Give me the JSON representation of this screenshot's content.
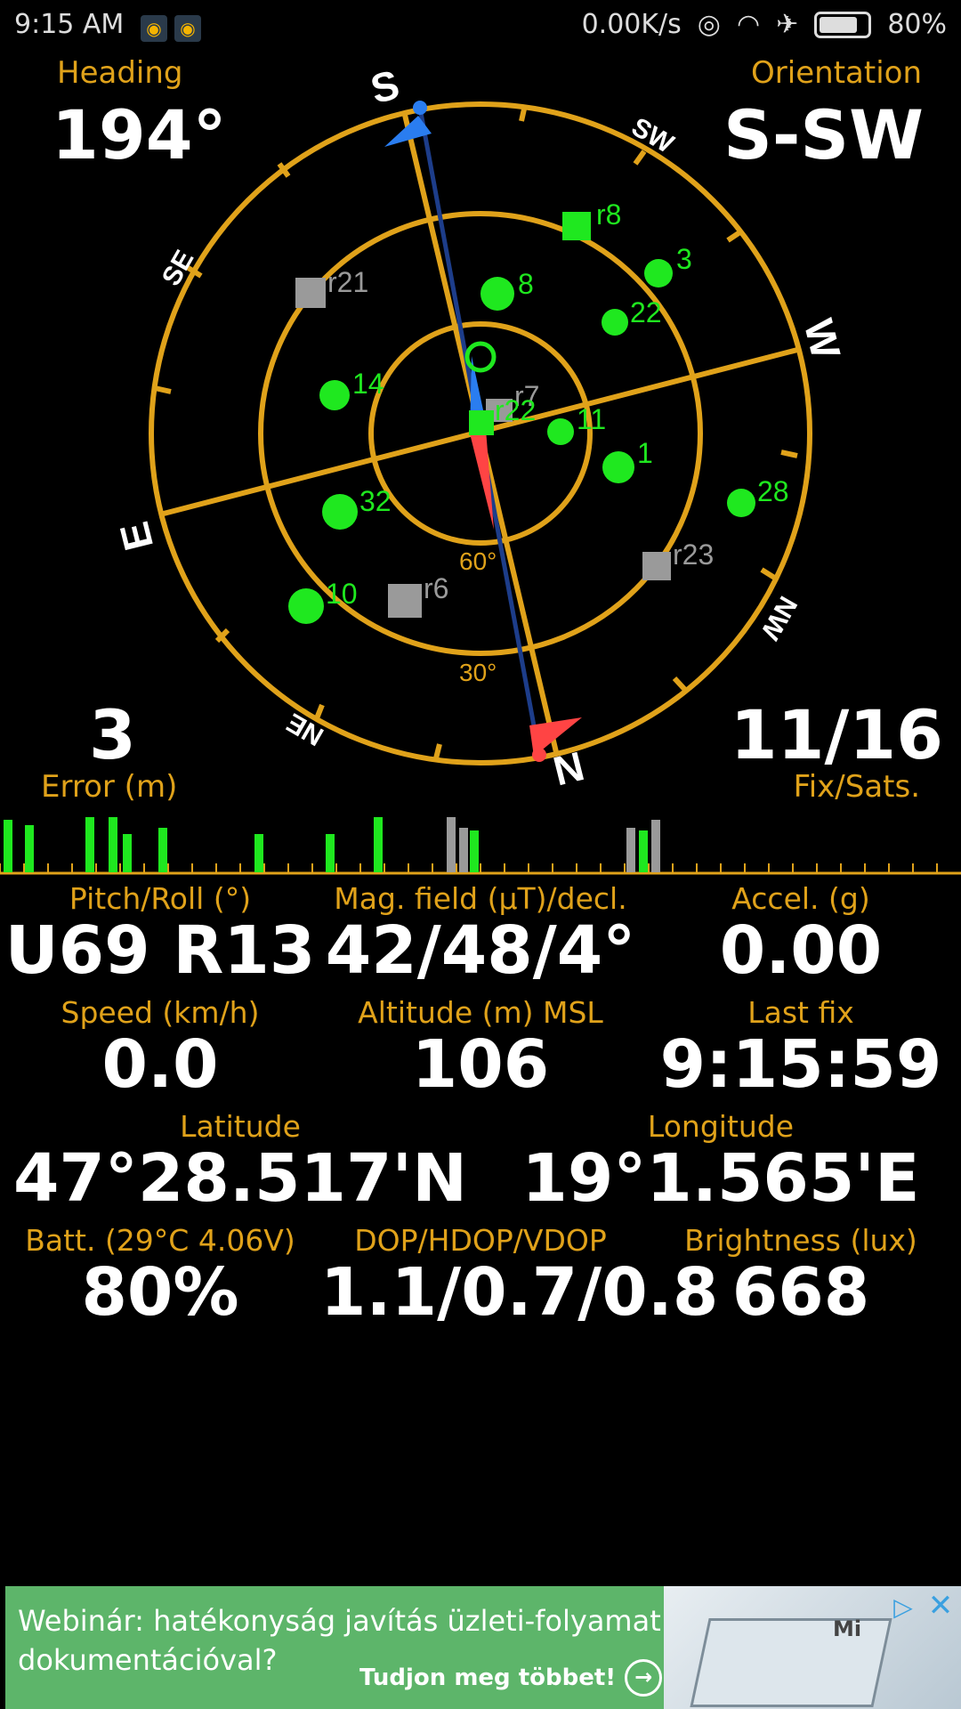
{
  "status_bar": {
    "time": "9:15 AM",
    "net_speed": "0.00K/s",
    "battery": "80%"
  },
  "header": {
    "heading_label": "Heading",
    "heading_value": "194°",
    "orientation_label": "Orientation",
    "orientation_value": "S-SW",
    "error_value": "3",
    "error_label": "Error (m)",
    "fix_value": "11/16",
    "fix_label": "Fix/Sats."
  },
  "compass": {
    "cardinals": {
      "S": "S",
      "SW": "SW",
      "W": "W",
      "NW": "NW",
      "N": "N",
      "NE": "NE",
      "E": "E",
      "SE": "SE"
    },
    "elev_60": "60°",
    "elev_30": "30°",
    "satellites": [
      {
        "id": "r8",
        "used": true,
        "type": "square"
      },
      {
        "id": "3",
        "used": true,
        "type": "circle"
      },
      {
        "id": "8",
        "used": true,
        "type": "circle"
      },
      {
        "id": "22",
        "used": true,
        "type": "circle"
      },
      {
        "id": "r21",
        "used": false,
        "type": "square"
      },
      {
        "id": "14",
        "used": true,
        "type": "circle"
      },
      {
        "id": "r7",
        "used": false,
        "type": "square"
      },
      {
        "id": "r22",
        "used": true,
        "type": "square"
      },
      {
        "id": "11",
        "used": true,
        "type": "circle"
      },
      {
        "id": "1",
        "used": true,
        "type": "circle"
      },
      {
        "id": "28",
        "used": true,
        "type": "circle"
      },
      {
        "id": "32",
        "used": true,
        "type": "circle"
      },
      {
        "id": "r23",
        "used": false,
        "type": "square"
      },
      {
        "id": "10",
        "used": true,
        "type": "circle"
      },
      {
        "id": "r6",
        "used": false,
        "type": "square"
      }
    ],
    "colors": {
      "ring": "#e0a21a",
      "used": "#1fe81f",
      "unused": "#9a9a9a",
      "needle_n": "#ff4444",
      "needle_s": "#2a7df0"
    }
  },
  "signal_bars": {
    "values": [
      0.95,
      0.85,
      1.0,
      1.0,
      0.7,
      0.8,
      0.7,
      0.7,
      1.0,
      1.0,
      0.8,
      0.75,
      0.8,
      0.75,
      0.95
    ],
    "used": [
      true,
      true,
      true,
      true,
      true,
      true,
      true,
      true,
      true,
      false,
      false,
      true,
      false,
      true,
      false
    ]
  },
  "metrics": {
    "pitch_label": "Pitch/Roll (°)",
    "pitch_value": "U69 R13",
    "mag_label": "Mag. field (µT)/decl.",
    "mag_value": "42/48/4°",
    "accel_label": "Accel. (g)",
    "accel_value": "0.00",
    "speed_label": "Speed (km/h)",
    "speed_value": "0.0",
    "alt_label": "Altitude (m) MSL",
    "alt_value": "106",
    "lastfix_label": "Last fix",
    "lastfix_value": "9:15:59",
    "lat_label": "Latitude",
    "lat_value": "47°28.517'N",
    "lon_label": "Longitude",
    "lon_value": "19°1.565'E",
    "batt_label": "Batt. (29°C 4.06V)",
    "batt_value": "80%",
    "dop_label": "DOP/HDOP/VDOP",
    "dop_value": "1.1/0.7/0.8",
    "bright_label": "Brightness (lux)",
    "bright_value": "668"
  },
  "ad": {
    "text_line1": "Webinár: hatékonyság javítás üzleti-folyamat",
    "text_line2": "dokumentációval?",
    "cta": "Tudjon meg többet!",
    "brand": "Mi"
  }
}
